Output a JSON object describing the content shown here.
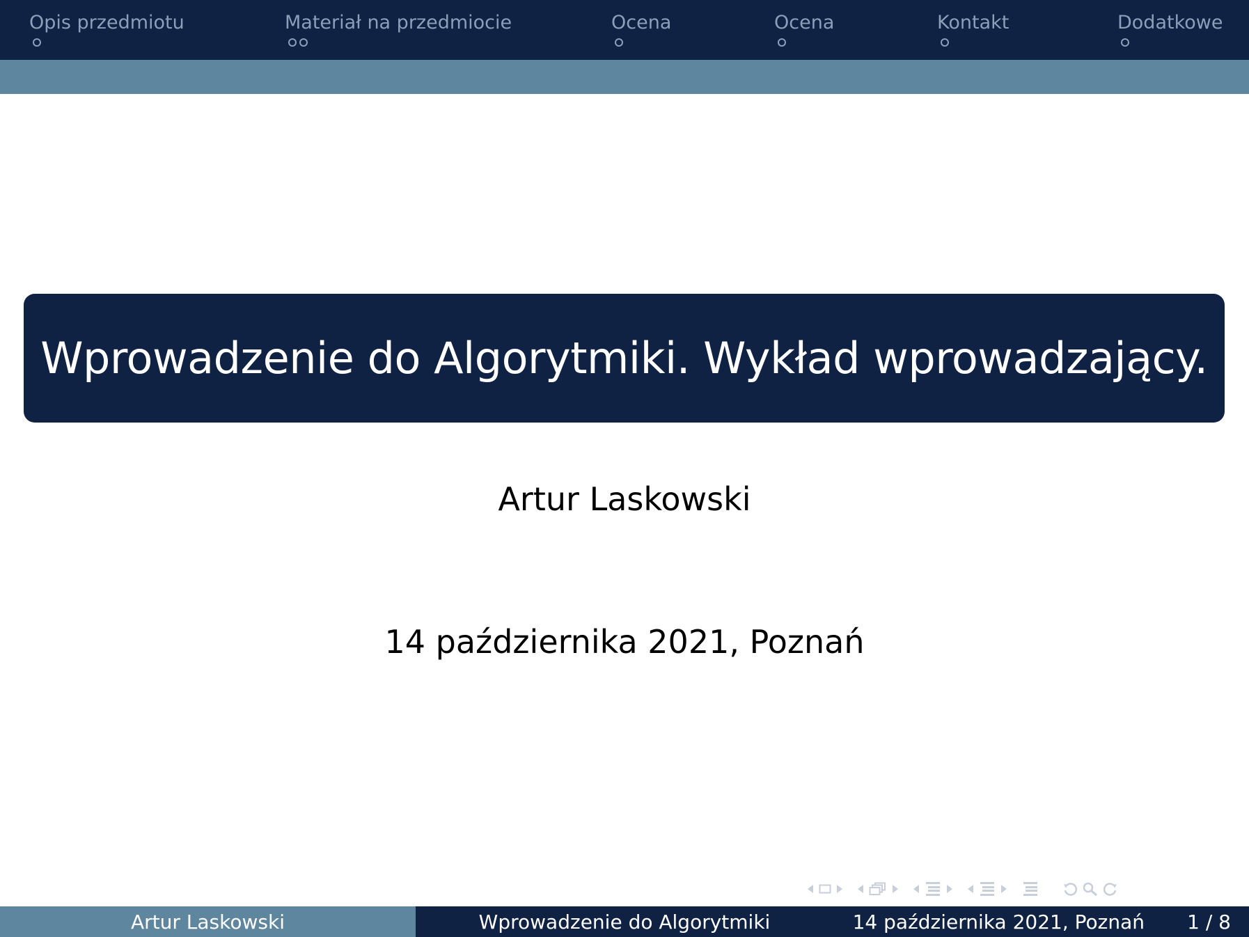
{
  "nav": {
    "sections": [
      {
        "label": "Opis przedmiotu",
        "dots": 1
      },
      {
        "label": "Materiał na przedmiocie",
        "dots": 2
      },
      {
        "label": "Ocena",
        "dots": 1
      },
      {
        "label": "Ocena",
        "dots": 1
      },
      {
        "label": "Kontakt",
        "dots": 1
      },
      {
        "label": "Dodatkowe",
        "dots": 1
      }
    ]
  },
  "title_slide": {
    "title": "Wprowadzenie do Algorytmiki. Wykład wprowadzający.",
    "author": "Artur Laskowski",
    "date_place": "14 października 2021, Poznań"
  },
  "footer": {
    "author": "Artur Laskowski",
    "short_title": "Wprowadzenie do Algorytmiki",
    "date_place": "14 października 2021, Poznań",
    "page": "1 / 8"
  },
  "nav_symbols": [
    "slide-icon",
    "frame-icon",
    "subsection-icon",
    "section-icon",
    "document-icon",
    "back-icon",
    "search-icon",
    "forward-icon"
  ],
  "colors": {
    "nav_bg": "#0f2244",
    "subnav_bg": "#5f869f",
    "nav_text": "#8c9fb9",
    "title_bg": "#0f2244"
  }
}
